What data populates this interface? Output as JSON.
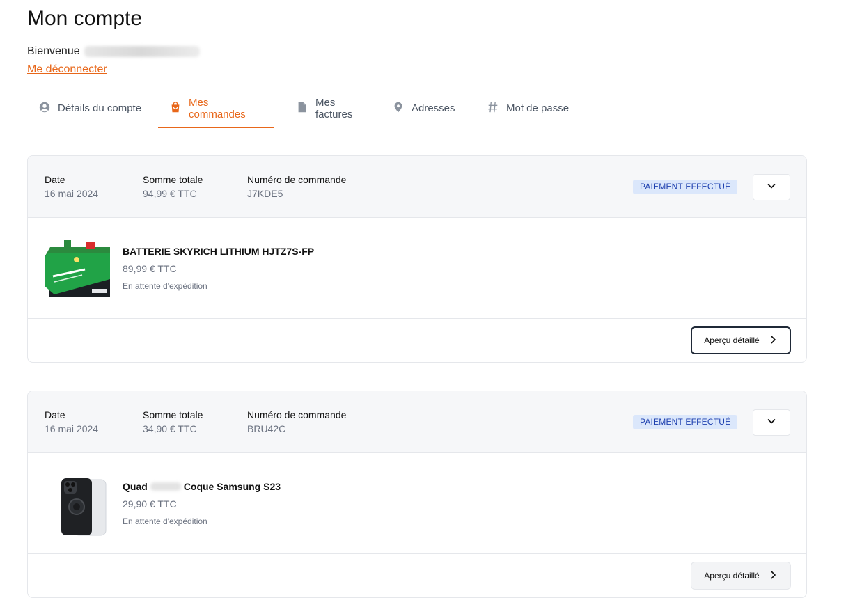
{
  "header": {
    "title": "Mon compte",
    "welcome_label": "Bienvenue",
    "logout_label": "Me déconnecter"
  },
  "tabs": [
    {
      "label": "Détails du compte",
      "icon": "user-circle-icon"
    },
    {
      "label": "Mes commandes",
      "icon": "shopping-bag-icon",
      "active": true
    },
    {
      "label": "Mes factures",
      "icon": "document-icon"
    },
    {
      "label": "Adresses",
      "icon": "map-pin-icon"
    },
    {
      "label": "Mot de passe",
      "icon": "hash-icon"
    }
  ],
  "labels": {
    "date": "Date",
    "total": "Somme totale",
    "order_number": "Numéro de commande",
    "detail_button": "Aperçu détaillé"
  },
  "orders": [
    {
      "date": "16 mai 2024",
      "total": "94,99 € TTC",
      "number": "J7KDE5",
      "status_badge": "PAIEMENT EFFECTUÉ",
      "item": {
        "name": "BATTERIE SKYRICH LITHIUM HJTZ7S-FP",
        "price": "89,99 € TTC",
        "status": "En attente d'expédition",
        "image": "battery-image"
      }
    },
    {
      "date": "16 mai 2024",
      "total": "34,90 € TTC",
      "number": "BRU42C",
      "status_badge": "PAIEMENT EFFECTUÉ",
      "item": {
        "name_start": "Quad",
        "name_end": "Coque Samsung S23",
        "price": "29,90 € TTC",
        "status": "En attente d'expédition",
        "image": "phone-case-image"
      }
    }
  ],
  "colors": {
    "accent": "#e8671a",
    "badge_bg": "#dbe7fb",
    "badge_text": "#1e40af",
    "header_bg": "#f6f7f9"
  }
}
